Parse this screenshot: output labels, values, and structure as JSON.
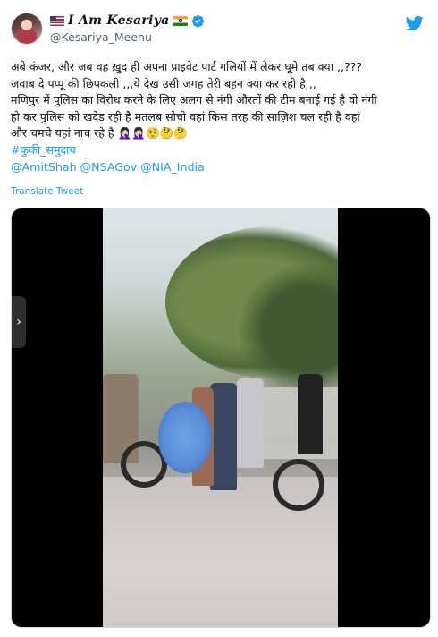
{
  "author": {
    "display_name": "I Am Kesariya",
    "handle": "@Kesariya_Meenu",
    "avatar_icon": "profile-photo",
    "verified_icon": "verified-badge-icon",
    "name_emojis": [
      "us-flag",
      "india-flag"
    ]
  },
  "tweet": {
    "lines": [
      "अबे कंजर, और जब वह ख़ुद ही अपना प्राइवेट पार्ट गलियों में लेकर घूमे तब क्या ,,???",
      "जवाब दे पप्पू की छिपकली ,,,ये देख उसी जगह तेरी बहन क्या कर रही है ,,",
      "मणिपुर में पुलिस का विरोध करने के लिए अलग से नंगी औरतों की टीम बनाई गई है वो नंगी",
      "हो कर पुलिस को खदेड रही है मतलब सोचो वहां किस तरह की साज़िश चल रही है वहां",
      "और चमचे यहां नाच रहे है 🤦🏻‍♀️🤦🏻‍♀️🤨🤔🤔"
    ],
    "hashtag": "#कुकी_समुदाय",
    "mentions": "@AmitShah @NSAGov @NIA_India",
    "translate_label": "Translate Tweet"
  },
  "media": {
    "type": "video",
    "prev_icon": "chevron-left-icon"
  },
  "colors": {
    "link": "#1d9bf0",
    "text": "#0f1419",
    "secondary": "#536471",
    "border": "#cfd9de"
  },
  "brand_icon": "twitter-bird-icon"
}
